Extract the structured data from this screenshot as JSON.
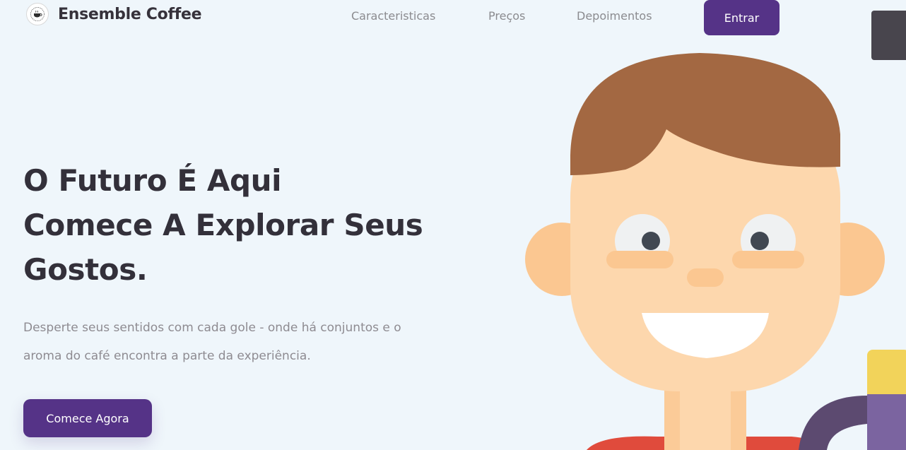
{
  "header": {
    "brand_name": "Ensemble Coffee",
    "nav": [
      {
        "label": "Caracteristicas"
      },
      {
        "label": "Preços"
      },
      {
        "label": "Depoimentos"
      }
    ],
    "login_label": "Entrar"
  },
  "hero": {
    "title_lines": [
      "O Futuro É Aqui",
      "Comece A Explorar Seus",
      "Gostos."
    ],
    "subtitle": "Desperte seus sentidos com cada gole - onde há conjuntos e o aroma do café encontra a parte da experiência.",
    "cta_label": "Comece Agora"
  },
  "colors": {
    "background": "#eff6fb",
    "accent": "#553387",
    "heading": "#33303a",
    "muted_text": "#8e8b91"
  },
  "icons": {
    "logo": "coffee-cup-logo-icon"
  }
}
